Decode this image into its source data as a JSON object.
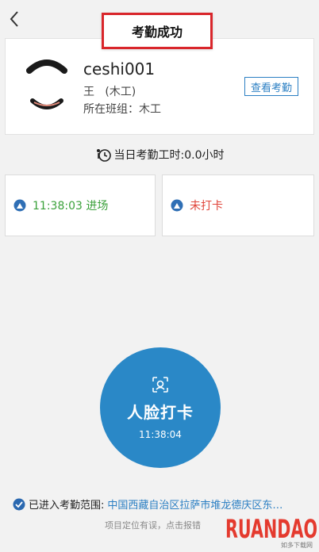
{
  "header": {
    "back_icon": "chevron-left-icon",
    "title": "考勤成功"
  },
  "profile": {
    "name": "ceshi001",
    "role": "王   (木工)",
    "team": "所在班组：木工",
    "view_button": "查看考勤"
  },
  "hours": {
    "text": "当日考勤工时:0.0小时"
  },
  "records": {
    "entry": {
      "text": "11:38:03 进场",
      "color": "#3aa13a"
    },
    "exit": {
      "text": "未打卡",
      "color": "#e0453a"
    }
  },
  "face": {
    "label": "人脸打卡",
    "time": "11:38:04",
    "color": "#2a88c7"
  },
  "range": {
    "label": "已进入考勤范围:",
    "location": "中国西藏自治区拉萨市堆龙德庆区东…",
    "report": "项目定位有误，点击报错"
  },
  "watermark": {
    "text": "RUANDAO",
    "sub": "如多下载网"
  }
}
